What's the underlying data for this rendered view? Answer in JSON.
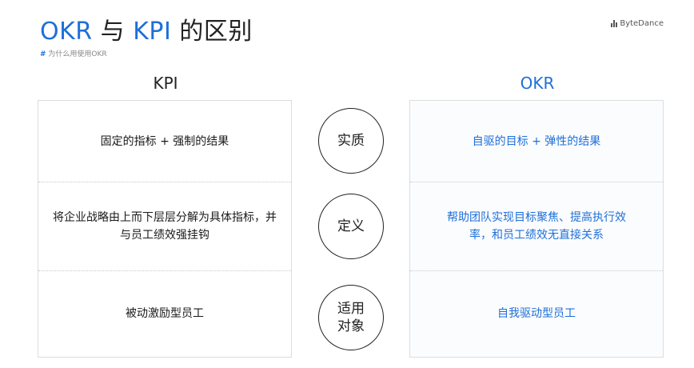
{
  "header": {
    "title_okr": "OKR",
    "title_mid": " 与 ",
    "title_kpi": "KPI",
    "title_rest": " 的区别",
    "subtitle_hash": "#",
    "subtitle": "为什么用使用OKR",
    "brand": "ByteDance"
  },
  "columns": {
    "left": "KPI",
    "right": "OKR"
  },
  "rows": [
    {
      "kpi": "固定的指标 + 强制的结果",
      "label": "实质",
      "okr": "自驱的目标 + 弹性的结果"
    },
    {
      "kpi": "将企业战略由上而下层层分解为具体指标，并与员工绩效强挂钩",
      "label": "定义",
      "okr": "帮助团队实现目标聚焦、提高执行效率，和员工绩效无直接关系"
    },
    {
      "kpi": "被动激励型员工",
      "label": "适用对象",
      "okr": "自我驱动型员工"
    }
  ],
  "colors": {
    "accent": "#1e6fd9",
    "text": "#222222"
  }
}
